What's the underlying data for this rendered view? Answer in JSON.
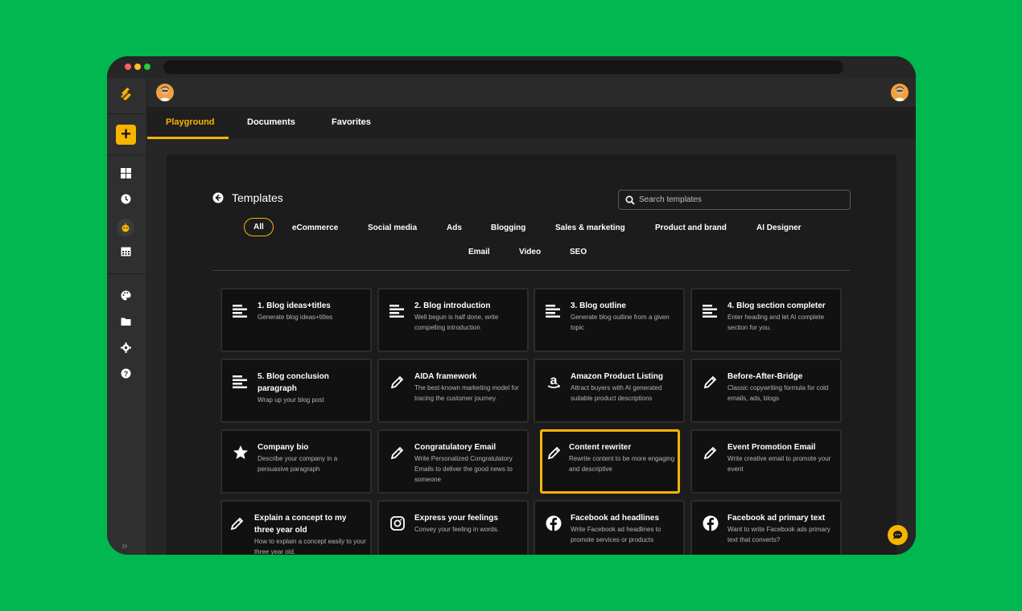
{
  "colors": {
    "background": "#00b84f",
    "accent": "#f7b500",
    "window": "#2a2a2a",
    "card": "#111111"
  },
  "sidebar": {
    "icons": [
      "logo-icon",
      "plus-icon",
      "dashboard-icon",
      "history-icon",
      "bot-icon",
      "calendar-icon",
      "palette-icon",
      "folder-icon",
      "gear-icon",
      "help-icon",
      "expand-icon"
    ],
    "add_label": "+"
  },
  "tabs": [
    {
      "label": "Playground",
      "active": true
    },
    {
      "label": "Documents",
      "active": false
    },
    {
      "label": "Favorites",
      "active": false
    }
  ],
  "templates": {
    "title": "Templates",
    "search_placeholder": "Search templates",
    "categories": [
      "All",
      "eCommerce",
      "Social media",
      "Ads",
      "Blogging",
      "Sales & marketing",
      "Product and brand",
      "AI Designer",
      "Email",
      "Video",
      "SEO"
    ],
    "active_category": "All",
    "cards": [
      {
        "title": "1. Blog ideas+titles",
        "desc": "Generate blog ideas+titles",
        "icon": "lines-icon"
      },
      {
        "title": "2. Blog introduction",
        "desc": "Well begun is half done, write compelling introduction",
        "icon": "lines-icon"
      },
      {
        "title": "3. Blog outline",
        "desc": "Generate blog outline from a given topic",
        "icon": "lines-icon"
      },
      {
        "title": "4. Blog section completer",
        "desc": "Enter heading and let AI complete section for you.",
        "icon": "lines-icon"
      },
      {
        "title": "5. Blog conclusion paragraph",
        "desc": "Wrap up your blog post",
        "icon": "lines-icon"
      },
      {
        "title": "AIDA framework",
        "desc": "The best-known marketing model for tracing the customer journey.",
        "icon": "pencil-icon"
      },
      {
        "title": "Amazon Product Listing",
        "desc": "Attract buyers with AI generated suitable product descriptions",
        "icon": "amazon-icon"
      },
      {
        "title": "Before-After-Bridge",
        "desc": "Classic copywriting formula for cold emails, ads, blogs",
        "icon": "pencil-icon"
      },
      {
        "title": "Company bio",
        "desc": "Describe your company in a persuasive paragraph",
        "icon": "star-icon"
      },
      {
        "title": "Congratulatory Email",
        "desc": "Write Personalized Congratulatory Emails to deliver the good news to someone",
        "icon": "pencil-icon"
      },
      {
        "title": "Content rewriter",
        "desc": "Rewrite content to be more engaging and descriptive",
        "icon": "pencil-icon",
        "selected": true
      },
      {
        "title": "Event Promotion Email",
        "desc": "Write creative email to promote your event",
        "icon": "pencil-icon"
      },
      {
        "title": "Explain a concept to my three year old",
        "desc": "How to explain a concept easily to your three year old.",
        "icon": "pencil-icon"
      },
      {
        "title": "Express your feelings",
        "desc": "Convey your feeling in words.",
        "icon": "instagram-icon"
      },
      {
        "title": "Facebook ad headlines",
        "desc": "Write Facebook ad headlines to promote services or products",
        "icon": "facebook-icon"
      },
      {
        "title": "Facebook ad primary text",
        "desc": "Want to write Facebook ads primary text that converts?",
        "icon": "facebook-icon"
      }
    ]
  }
}
